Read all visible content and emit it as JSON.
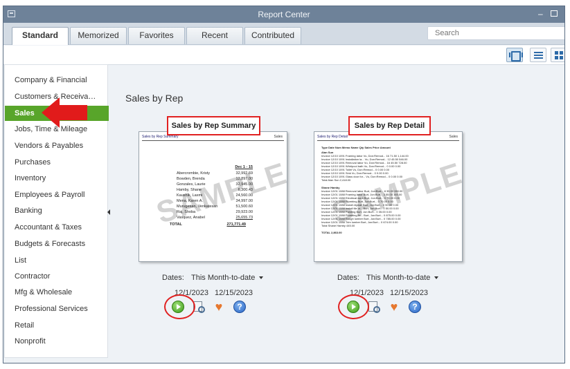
{
  "window": {
    "title": "Report Center"
  },
  "tabs": [
    {
      "label": "Standard",
      "active": true
    },
    {
      "label": "Memorized",
      "active": false
    },
    {
      "label": "Favorites",
      "active": false
    },
    {
      "label": "Recent",
      "active": false
    },
    {
      "label": "Contributed",
      "active": false
    }
  ],
  "search": {
    "placeholder": "Search"
  },
  "toolbar": {
    "views": [
      "carousel-view-icon",
      "list-view-icon",
      "grid-view-icon"
    ],
    "selected_view": "carousel"
  },
  "sidebar": {
    "items": [
      {
        "label": "Company & Financial"
      },
      {
        "label": "Customers & Receiva…"
      },
      {
        "label": "Sales",
        "active": true
      },
      {
        "label": "Jobs, Time & Mileage"
      },
      {
        "label": "Vendors & Payables"
      },
      {
        "label": "Purchases"
      },
      {
        "label": "Inventory"
      },
      {
        "label": "Employees & Payroll"
      },
      {
        "label": "Banking"
      },
      {
        "label": "Accountant & Taxes"
      },
      {
        "label": "Budgets & Forecasts"
      },
      {
        "label": "List"
      },
      {
        "label": "Contractor"
      },
      {
        "label": "Mfg & Wholesale"
      },
      {
        "label": "Professional Services"
      },
      {
        "label": "Retail"
      },
      {
        "label": "Nonprofit"
      }
    ]
  },
  "main": {
    "section_title": "Sales by Rep",
    "reports": [
      {
        "title": "Sales by Rep Summary",
        "thumb_header": "Sales by Rep Summary",
        "thumb_header_right": "Sales",
        "watermark": "SAMPLE",
        "thumb_col_header": "Dec 1 - 15",
        "thumb_rows": [
          {
            "name": "Abercrombie, Kristy",
            "value": "32,992.69"
          },
          {
            "name": "Bowden, Brenda",
            "value": "12,897.00"
          },
          {
            "name": "Gonzales, Laurie",
            "value": "32,945.00"
          },
          {
            "name": "Hamby, Shane",
            "value": "6,300.43"
          },
          {
            "name": "Kaushik, Laxmi",
            "value": "24,560.00"
          },
          {
            "name": "Mena, Karen A.",
            "value": "34,997.00"
          },
          {
            "name": "Murugesan, Venkatesan",
            "value": "51,500.60"
          },
          {
            "name": "Raj, Shoba",
            "value": "29,923.00"
          },
          {
            "name": "Vasquez, Anabel",
            "value": "25,655.73"
          }
        ],
        "thumb_total_label": "TOTAL",
        "thumb_total_value": "271,771.49",
        "dates_label": "Dates:",
        "dates_value": "This Month-to-date",
        "from": "12/1/2023",
        "to": "12/15/2023"
      },
      {
        "title": "Sales by Rep Detail",
        "thumb_header": "Sales by Rep Detail",
        "thumb_header_right": "Sales",
        "watermark": "SAMPLE",
        "thumb_columns": "Type   Date   Num   Memo   Name   Qty  Sales Price  Amount",
        "thumb_rows": [
          "Alan Sun",
          "Invoice  12/10  1091  Framing labor   Vu, Don:Remod...  16   71.50   1,144.00",
          "Invoice  12/10  1091  Installation la...  Vu, Don:Remod...  12   45.50   546.00",
          "Invoice  12/10  1091  Removal labor   Vu, Don:Remod...  16   45.50   728.00",
          "Invoice  12/10  1091  Whirlpool bath   Vu, Don:Remod...   0   0.00   0.00",
          "Invoice  12/10  1091  Toilet   Vu, Don:Remod...   0   0.00   0.00",
          "Invoice  12/10  1091  Sink   Vu, Don:Remod...   0   0.00   0.00",
          "Invoice  12/10  1091  Glass door for...  Vu, Don:Remod...   0   0.00   0.00",
          "Total Alan Sun   2,418.00",
          "Shane Hamby",
          "Invoice  12/01  1088  Removal labor   Burt, Jon:Burt...   8   35.00   280.00",
          "Invoice  12/01  1088  Framing labor   Burt, Jon:Burt...   3   55.00   165.00",
          "Invoice  12/01  1088  Electrical work   Burt, Jon:Burt...   0   75.00   0.00",
          "Invoice  12/01  1088  Plumbing   Burt, Jon:Burt...   0   70.00   0.00",
          "Invoice  12/01  1088  Install drywall   Burt, Jon:Burt...   0   50.00   0.00",
          "Invoice  12/01  1088  Install tile or...  Burt, Jon:Burt...   0   50.00   0.00",
          "Invoice  12/01  1088  Painting   Burt, Jon:Burt...   0   35.00   0.00",
          "Invoice  12/01  1088  Plumbing fix...  Burt, Jon:Burt...   0   875.00   0.00",
          "Invoice  12/01  1088  Rough lumber   Burt, Jon:Burt...   0   785.00   0.00",
          "Invoice  12/01  1088  Trim lumber   Burt, Jon:Burt...   0   674.00   0.00",
          "Total Shane Hamby   445.00",
          "TOTAL   2,863.00"
        ],
        "dates_label": "Dates:",
        "dates_value": "This Month-to-date",
        "from": "12/1/2023",
        "to": "12/15/2023"
      }
    ]
  },
  "colors": {
    "accent": "#58a52a",
    "titlebar": "#6e8299",
    "annotation": "#e02020"
  }
}
